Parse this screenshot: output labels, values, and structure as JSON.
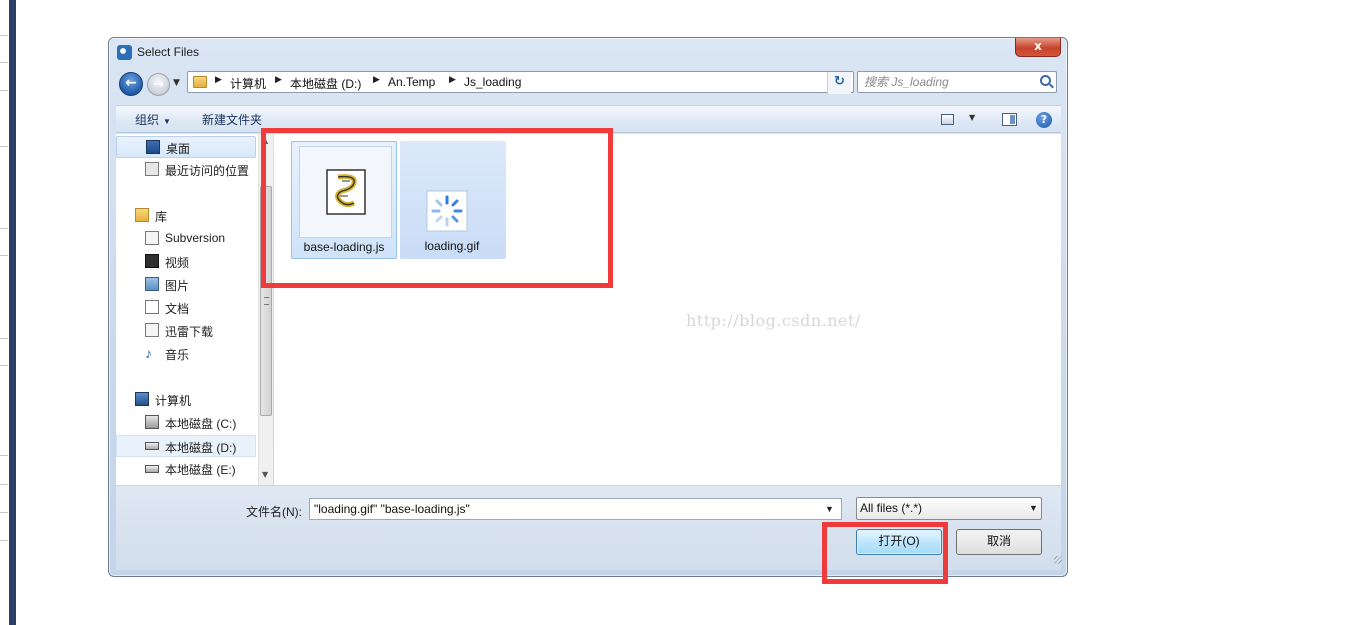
{
  "dialog": {
    "title": "Select Files",
    "close_glyph": "x"
  },
  "address": {
    "crumbs": [
      "计算机",
      "本地磁盘 (D:)",
      "An.Temp",
      "Js_loading"
    ]
  },
  "search": {
    "placeholder": "搜索 Js_loading"
  },
  "toolbar": {
    "organize_label": "组织",
    "new_folder_label": "新建文件夹"
  },
  "nav": {
    "favorites": [
      "桌面",
      "最近访问的位置"
    ],
    "libraries_header": "库",
    "libraries": [
      "Subversion",
      "视频",
      "图片",
      "文档",
      "迅雷下载",
      "音乐"
    ],
    "computer_header": "计算机",
    "drives": [
      "本地磁盘 (C:)",
      "本地磁盘 (D:)",
      "本地磁盘 (E:)"
    ],
    "selected": "本地磁盘 (D:)"
  },
  "files": [
    {
      "name": "base-loading.js",
      "icon": "script-file-icon",
      "selected": true
    },
    {
      "name": "loading.gif",
      "icon": "loading-spinner-icon",
      "selected": true
    }
  ],
  "watermark": "http://blog.csdn.net/",
  "footer": {
    "filename_label": "文件名(N):",
    "filename_value": "\"loading.gif\" \"base-loading.js\"",
    "filter_value": "All files (*.*)",
    "open_label": "打开(O)",
    "cancel_label": "取消"
  },
  "colors": {
    "highlight": "#ef3b3b",
    "selection": "#cfe3f9",
    "left_rail": "#2c3e66"
  }
}
